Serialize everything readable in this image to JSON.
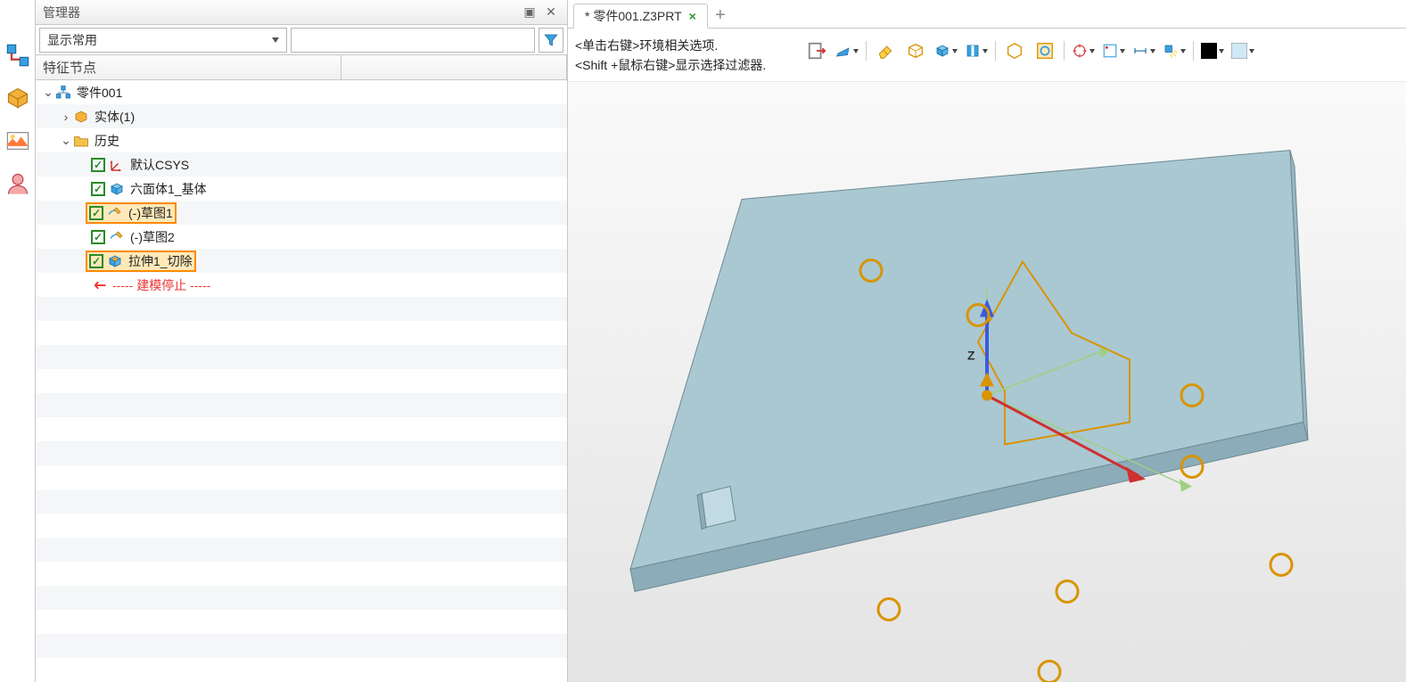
{
  "panel": {
    "title": "管理器",
    "filter_combo": "显示常用",
    "column_header": "特征节点"
  },
  "tree": {
    "root": "零件001",
    "solids": "实体(1)",
    "history": "历史",
    "items": [
      "默认CSYS",
      "六面体1_基体",
      "(-)草图1",
      "(-)草图2",
      "拉伸1_切除"
    ],
    "stop": "----- 建模停止 -----"
  },
  "tab": {
    "label": "* 零件001.Z3PRT"
  },
  "hints": {
    "line1": "<单击右键>环境相关选项.",
    "line2": "<Shift +鼠标右键>显示选择过滤器."
  },
  "axis_label": "Z"
}
